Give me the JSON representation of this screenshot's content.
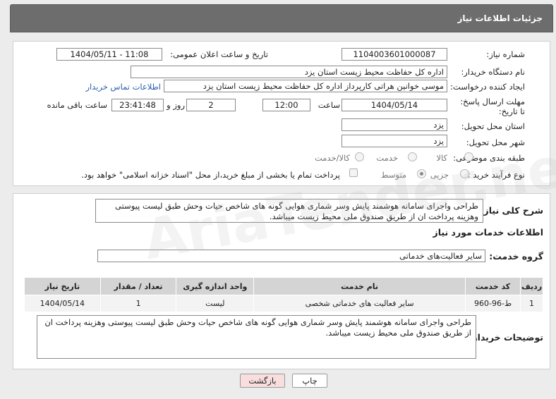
{
  "header": {
    "title": "جزئیات اطلاعات نیاز"
  },
  "form": {
    "need_number_label": "شماره نیاز:",
    "need_number": "1104003601000087",
    "announce_label": "تاریخ و ساعت اعلان عمومی:",
    "announce_value": "1404/05/11 - 11:08",
    "buyer_org_label": "نام دستگاه خریدار:",
    "buyer_org": "اداره کل حفاظت محیط زیست استان یزد",
    "creator_label": "ایجاد کننده درخواست:",
    "creator": "موسی خوانین هراتی کارپرداز اداره کل حفاظت محیط زیست استان یزد",
    "buyer_contact_link": "اطلاعات تماس خریدار",
    "deadline_label": "مهلت ارسال پاسخ: تا تاریخ:",
    "deadline_date": "1404/05/14",
    "time_label": "ساعت",
    "deadline_time": "12:00",
    "days_value": "2",
    "days_label": "روز و",
    "remaining_time": "23:41:48",
    "remaining_label": "ساعت باقی مانده",
    "province_label": "استان محل تحویل:",
    "province": "یزد",
    "city_label": "شهر محل تحویل:",
    "city": "یزد",
    "category_label": "طبقه بندی موضوعی:",
    "category_options": [
      "کالا",
      "خدمت",
      "کالا/خدمت"
    ],
    "purchase_type_label": "نوع فرآیند خرید :",
    "purchase_options": [
      "جزیی",
      "متوسط"
    ],
    "payment_note": "پرداخت تمام یا بخشی از مبلغ خرید،از محل \"اسناد خزانه اسلامی\" خواهد بود."
  },
  "summary": {
    "label": "شرح کلی نیاز:",
    "text": "طراحی واجرای سامانه هوشمند پایش وسر شماری هوایی گونه های شاخص حیات وحش  طبق لیست پیوستی وهزینه  پرداخت ان از طریق صندوق ملی محیط زیست میباشد."
  },
  "services": {
    "title": "اطلاعات خدمات مورد نیاز",
    "group_label": "گروه خدمت:",
    "group_value": "سایر فعالیت‌های خدماتی",
    "columns": [
      "ردیف",
      "کد خدمت",
      "نام خدمت",
      "واحد اندازه گیری",
      "تعداد / مقدار",
      "تاریخ نیاز"
    ],
    "rows": [
      [
        "1",
        "ط-96-960",
        "سایر فعالیت های خدماتی شخصی",
        "لیست",
        "1",
        "1404/05/14"
      ]
    ]
  },
  "buyer_notes": {
    "label": "توضیحات خریدار:",
    "text": "طراحی واجرای سامانه هوشمند پایش وسر شماری هوایی گونه های شاخص حیات وحش  طبق لیست پیوستی وهزینه  پرداخت ان از طریق صندوق ملی محیط زیست میباشد."
  },
  "buttons": {
    "print": "چاپ",
    "back": "بازگشت"
  },
  "watermark": "AriaTender.neT",
  "colors": {
    "header_bg": "#6d6d6d",
    "back_button_bg": "#f9dede",
    "link": "#2a5db0"
  }
}
